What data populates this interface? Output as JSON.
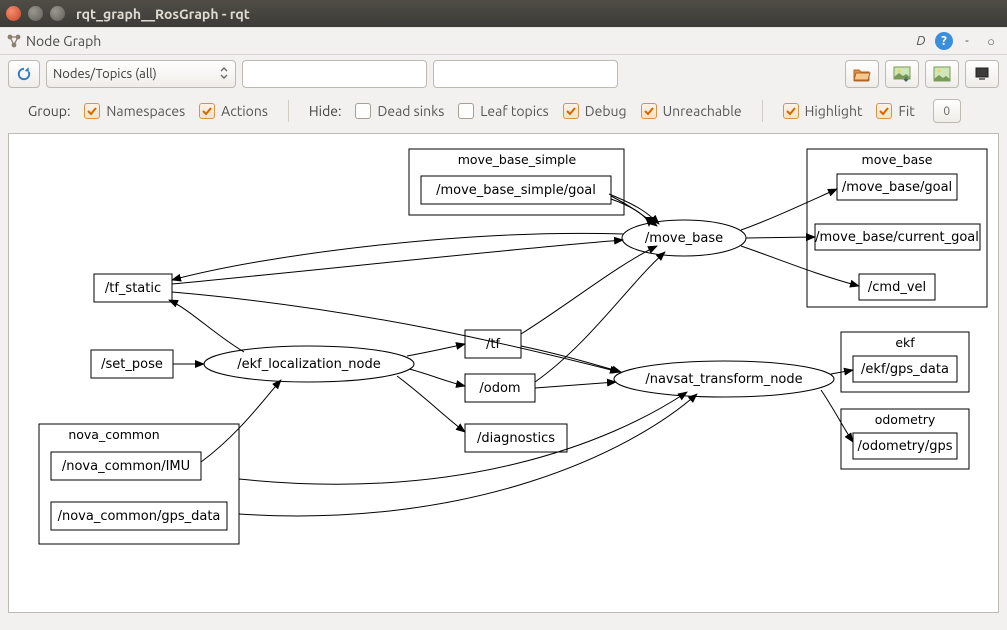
{
  "window": {
    "title": "rqt_graph__RosGraph - rqt"
  },
  "panel": {
    "tab": "Node Graph",
    "d_btn": "D",
    "help": "?",
    "minus": "-",
    "circle": "O"
  },
  "toolbar": {
    "refresh": "⟳",
    "combo_value": "Nodes/Topics (all)",
    "filter1": "",
    "filter2": "",
    "btns": {
      "open": "open",
      "save": "save",
      "image": "image",
      "pause": "pause"
    }
  },
  "opts": {
    "group_label": "Group:",
    "namespaces": "Namespaces",
    "actions": "Actions",
    "hide_label": "Hide:",
    "dead_sinks": "Dead sinks",
    "leaf_topics": "Leaf topics",
    "debug": "Debug",
    "unreachable": "Unreachable",
    "highlight": "Highlight",
    "fit": "Fit",
    "number": "0",
    "checked": {
      "namespaces": true,
      "actions": true,
      "dead_sinks": false,
      "leaf_topics": false,
      "debug": true,
      "unreachable": true,
      "highlight": true,
      "fit": true
    }
  },
  "graph": {
    "clusters": {
      "move_base_simple": {
        "title": "move_base_simple",
        "topics": [
          "/move_base_simple/goal"
        ]
      },
      "move_base": {
        "title": "move_base",
        "topics": [
          "/move_base/goal",
          "/move_base/current_goal",
          "/cmd_vel"
        ]
      },
      "ekf": {
        "title": "ekf",
        "topics": [
          "/ekf/gps_data"
        ]
      },
      "odometry": {
        "title": "odometry",
        "topics": [
          "/odometry/gps"
        ]
      },
      "nova_common": {
        "title": "nova_common",
        "topics": [
          "/nova_common/IMU",
          "/nova_common/gps_data"
        ]
      }
    },
    "topics": {
      "tf_static": "/tf_static",
      "set_pose": "/set_pose",
      "tf": "/tf",
      "odom": "/odom",
      "diagnostics": "/diagnostics"
    },
    "nodes": {
      "ekf_localization_node": "/ekf_localization_node",
      "move_base": "/move_base",
      "navsat_transform_node": "/navsat_transform_node"
    }
  }
}
